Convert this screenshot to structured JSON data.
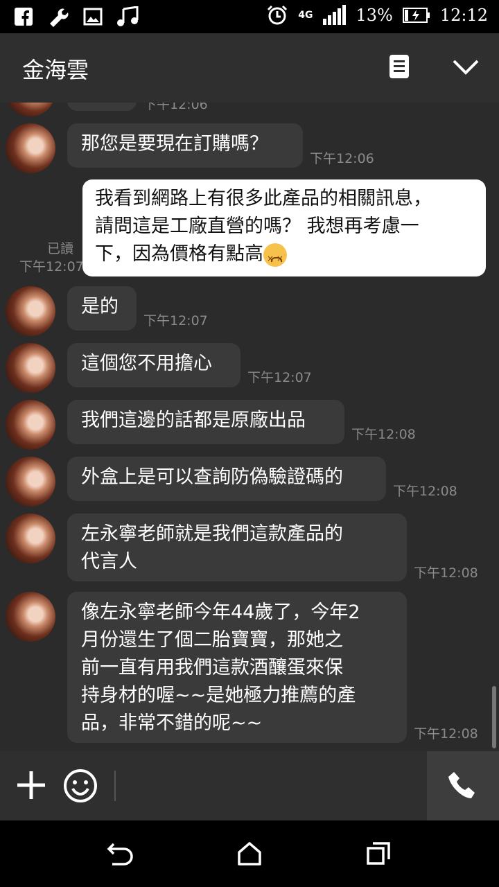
{
  "statusbar": {
    "battery": "13%",
    "network": "4G",
    "time": "12:12"
  },
  "header": {
    "title": "金海雲"
  },
  "messages": {
    "m0_time": "下午12:06",
    "m1_text": "那您是要現在訂購嗎？",
    "m1_time": "下午12:06",
    "m2_line1": "我看到網路上有很多此產品的相關訊息，",
    "m2_line2": "請問這是工廠直營的嗎？ 我想再考慮一",
    "m2_line3": "下，因為價格有點高",
    "m2_read": "已讀",
    "m2_time": "下午12:07",
    "m3_text": "是的",
    "m3_time": "下午12:07",
    "m4_text": "這個您不用擔心",
    "m4_time": "下午12:07",
    "m5_text": "我們這邊的話都是原廠出品",
    "m5_time": "下午12:08",
    "m6_text": "外盒上是可以查詢防偽驗證碼的",
    "m6_time": "下午12:08",
    "m7_line1": "左永寧老師就是我們這款產品的",
    "m7_line2": "代言人",
    "m7_time": "下午12:08",
    "m8_line1": "像左永寧老師今年44歲了，今年2",
    "m8_line2": "月份還生了個二胎寶寶，那她之",
    "m8_line3": "前一直有用我們這款酒釀蛋來保",
    "m8_line4": "持身材的喔~~是她極力推薦的產",
    "m8_line5": "品，非常不錯的呢~~",
    "m8_time": "下午12:08"
  }
}
